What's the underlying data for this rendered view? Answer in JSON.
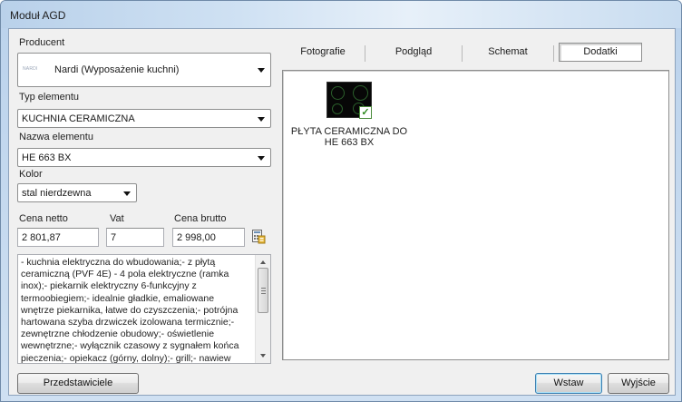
{
  "window": {
    "title": "Moduł AGD"
  },
  "producer": {
    "label": "Producent",
    "logo_text": "NARDI",
    "value": "Nardi (Wyposażenie kuchni)"
  },
  "element_type": {
    "label": "Typ elementu",
    "value": "KUCHNIA CERAMICZNA"
  },
  "element_name": {
    "label": "Nazwa elementu",
    "value": "HE 663 BX"
  },
  "color": {
    "label": "Kolor",
    "value": "stal nierdzewna"
  },
  "price": {
    "net_label": "Cena netto",
    "net_value": "2 801,87",
    "vat_label": "Vat",
    "vat_value": "7",
    "gross_label": "Cena brutto",
    "gross_value": "2 998,00",
    "calc_icon": "calculator-icon"
  },
  "description": {
    "text": "- kuchnia elektryczna do wbudowania;- z płytą\nceramiczną (PVF 4E) - 4 pola elektryczne (ramka\ninox);- piekarnik elektryczny 6-funkcyjny z\ntermoobiegiem;- idealnie gładkie, emaliowane\nwnętrze piekarnika, łatwe do   czyszczenia;- potrójna\nhartowana szyba drzwiczek izolowana termicznie;-\nzewnętrzne chłodzenie obudowy;- oświetlenie\nwewnętrzne;- wyłącznik czasowy z sygnałem końca\npieczenia;- opiekacz (górny, dolny);- grill;- nawiew"
  },
  "tabs": [
    {
      "label": "Fotografie",
      "active": false
    },
    {
      "label": "Podgląd",
      "active": false
    },
    {
      "label": "Schemat",
      "active": false
    },
    {
      "label": "Dodatki",
      "active": true
    }
  ],
  "addon": {
    "caption": "PŁYTA CERAMICZNA DO HE 663 BX",
    "checked": true,
    "check_icon": "checkmark-icon"
  },
  "buttons": {
    "reps": "Przedstawiciele",
    "insert": "Wstaw",
    "exit": "Wyjście"
  },
  "colors": {
    "title_bg": "#c9dcf0",
    "client_bg": "#f0f0f0",
    "default_btn_border": "#3c7fb1",
    "check_green": "#2f8a1f"
  }
}
